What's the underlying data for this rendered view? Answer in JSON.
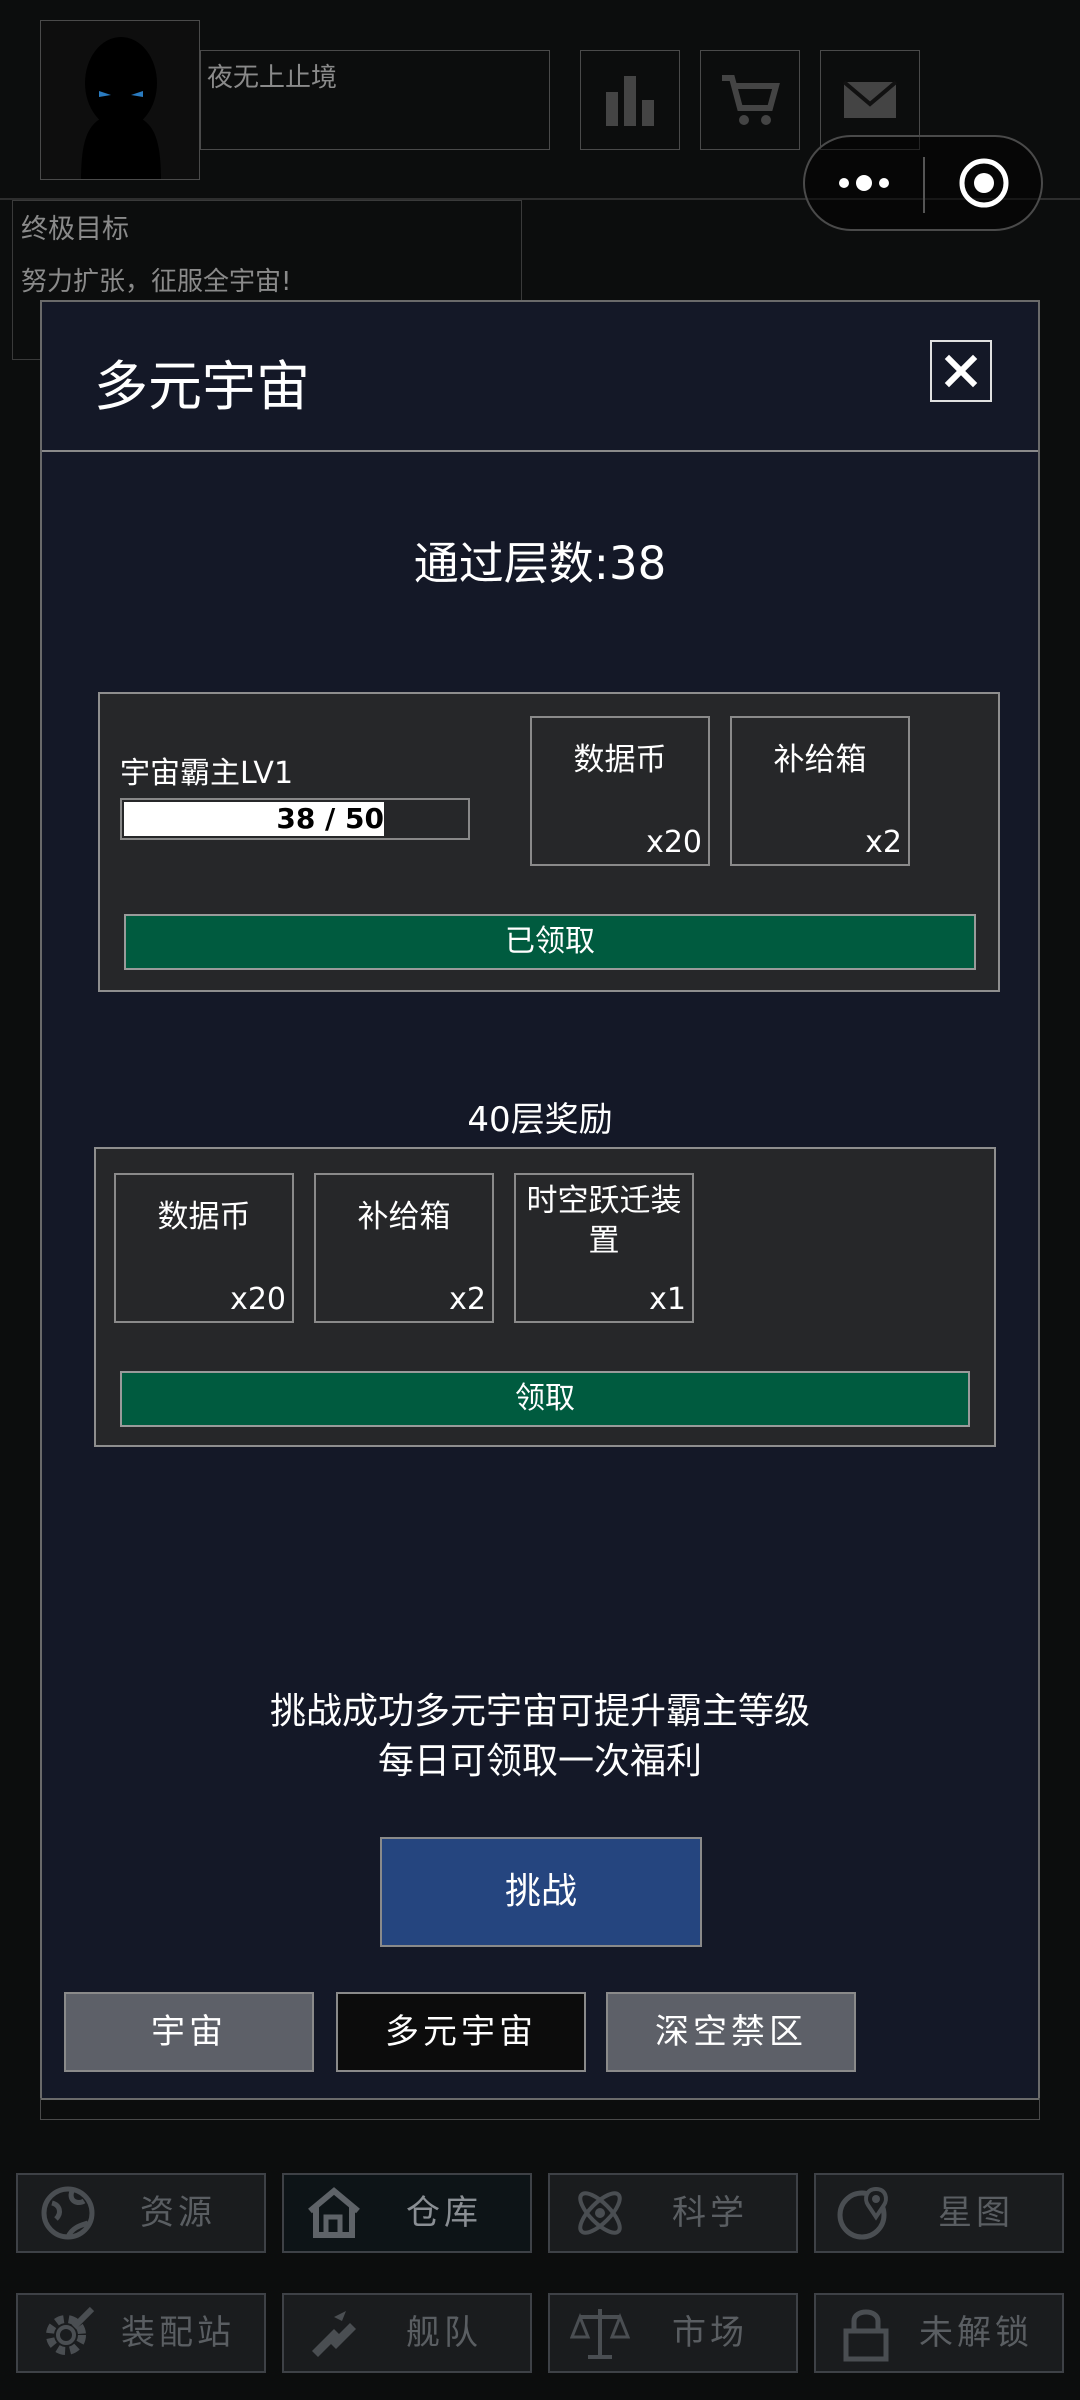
{
  "header": {
    "player_name": "夜无上止境",
    "goal_title": "终极目标",
    "goal_text": "努力扩张，征服全宇宙!"
  },
  "modal": {
    "title": "多元宇宙",
    "passed_layers": "通过层数:38",
    "current_reward": {
      "level_label": "宇宙霸主LV1",
      "progress_text": "38 / 50",
      "progress_fraction": 0.76,
      "items": [
        {
          "name": "数据币",
          "count": "x20"
        },
        {
          "name": "补给箱",
          "count": "x2"
        }
      ],
      "claim_label": "已领取"
    },
    "next_reward": {
      "title": "40层奖励",
      "items": [
        {
          "name": "数据币",
          "count": "x20"
        },
        {
          "name": "补给箱",
          "count": "x2"
        },
        {
          "name": "时空跃迁装置",
          "count": "x1"
        }
      ],
      "claim_label": "领取"
    },
    "hint_line1": "挑战成功多元宇宙可提升霸主等级",
    "hint_line2": "每日可领取一次福利",
    "challenge_label": "挑战",
    "tabs": [
      {
        "label": "宇宙",
        "active": false
      },
      {
        "label": "多元宇宙",
        "active": true
      },
      {
        "label": "深空禁区",
        "active": false
      }
    ]
  },
  "nav": [
    {
      "label": "资源",
      "icon": "globe-icon"
    },
    {
      "label": "仓库",
      "icon": "warehouse-icon"
    },
    {
      "label": "科学",
      "icon": "atom-icon"
    },
    {
      "label": "星图",
      "icon": "map-pin-icon"
    },
    {
      "label": "装配站",
      "icon": "gear-wrench-icon"
    },
    {
      "label": "舰队",
      "icon": "fleet-icon"
    },
    {
      "label": "市场",
      "icon": "scales-icon"
    },
    {
      "label": "未解锁",
      "icon": "lock-icon"
    }
  ],
  "colors": {
    "modal_bg": "#141827",
    "panel_bg": "#262729",
    "claim_green": "#005b3f",
    "challenge_blue": "#25457f",
    "tab_inactive": "#5d6068"
  }
}
